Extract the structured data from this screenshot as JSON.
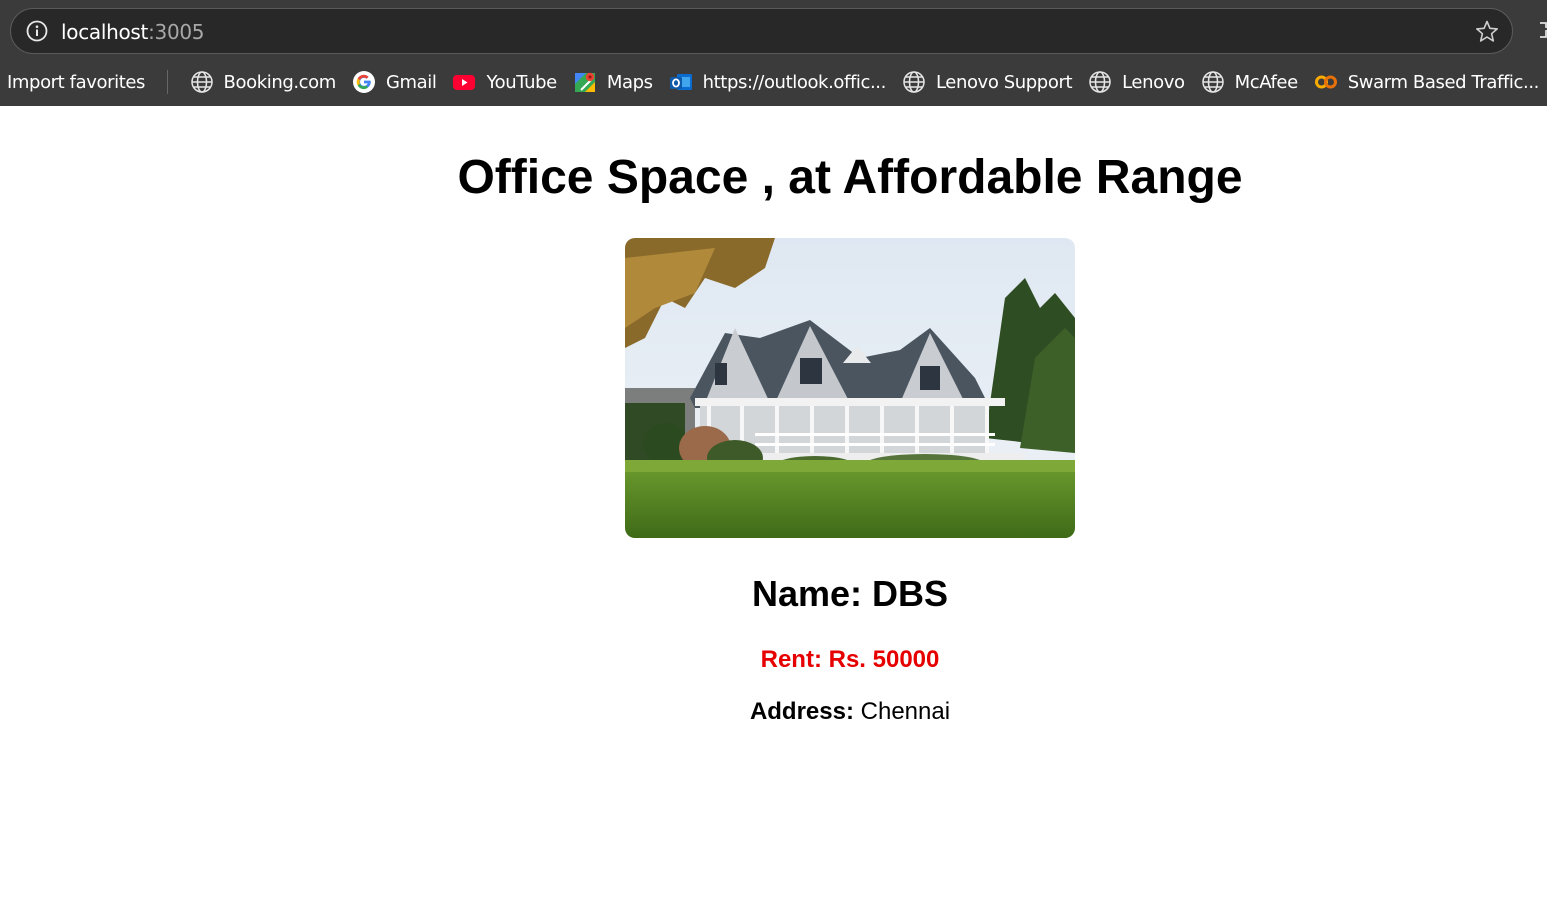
{
  "browser": {
    "url_host": "localhost",
    "url_port": ":3005",
    "bookmarks": [
      {
        "label": "Import favorites",
        "icon": "none"
      },
      {
        "label": "Booking.com",
        "icon": "globe-icon"
      },
      {
        "label": "Gmail",
        "icon": "google-icon"
      },
      {
        "label": "YouTube",
        "icon": "youtube-icon"
      },
      {
        "label": "Maps",
        "icon": "maps-icon"
      },
      {
        "label": "https://outlook.offic...",
        "icon": "outlook-icon"
      },
      {
        "label": "Lenovo Support",
        "icon": "globe-icon"
      },
      {
        "label": "Lenovo",
        "icon": "globe-icon"
      },
      {
        "label": "McAfee",
        "icon": "globe-icon"
      },
      {
        "label": "Swarm Based Traffic...",
        "icon": "colab-icon"
      }
    ]
  },
  "page": {
    "title": "Office Space , at Affordable Range",
    "image_alt": "house photo",
    "name_label": "Name: DBS",
    "rent_label": "Rent: Rs. 50000",
    "address_label": "Address:",
    "address_value": " Chennai"
  },
  "colors": {
    "chrome_bg": "#3b3b3b",
    "addressbar_bg": "#282828",
    "rent": "#e60000"
  }
}
